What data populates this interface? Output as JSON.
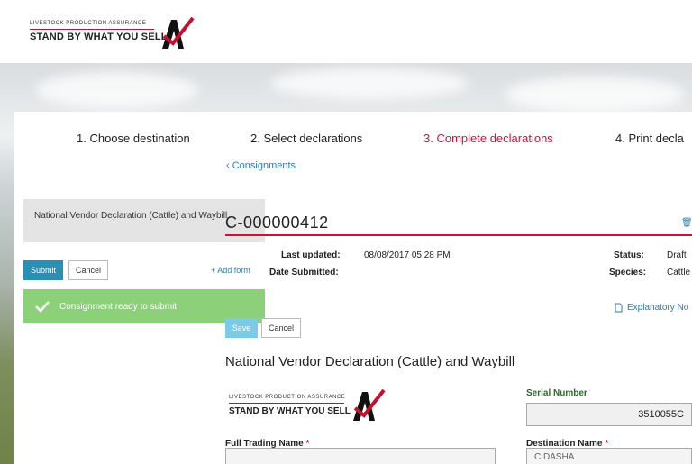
{
  "brand": {
    "small": "LIVESTOCK PRODUCTION ASSURANCE",
    "big": "STAND BY WHAT YOU SELL",
    "accent": "#c8102e"
  },
  "steps": [
    {
      "label": "1. Choose destination",
      "active": false
    },
    {
      "label": "2. Select declarations",
      "active": false
    },
    {
      "label": "3. Complete declarations",
      "active": true
    },
    {
      "label": "4. Print decla",
      "active": false
    }
  ],
  "nav": {
    "back_label": "Consignments"
  },
  "sidebar": {
    "form_item": "National Vendor Declaration (Cattle) and Waybill",
    "submit_label": "Submit",
    "cancel_label": "Cancel",
    "add_form_label": "+ Add form",
    "toast": "Consignment ready to submit"
  },
  "consignment": {
    "id": "C-000000412",
    "last_updated_label": "Last updated:",
    "last_updated_value": "08/08/2017 05:28 PM",
    "date_submitted_label": "Date Submitted:",
    "status_label": "Status:",
    "status_value": "Draft",
    "species_label": "Species:",
    "species_value": "Cattle"
  },
  "form": {
    "explanatory_label": "Explanatory No",
    "save_label": "Save",
    "cancel_label": "Cancel",
    "title": "National Vendor Declaration (Cattle) and Waybill",
    "serial_label": "Serial Number",
    "serial_value": "3510055C",
    "trading_name_label": "Full Trading Name",
    "destination_label": "Destination Name",
    "destination_value": "C DASHA"
  },
  "colors": {
    "primary": "#2a8fb5",
    "active_step": "#d0103a",
    "success": "#8cd07a"
  }
}
